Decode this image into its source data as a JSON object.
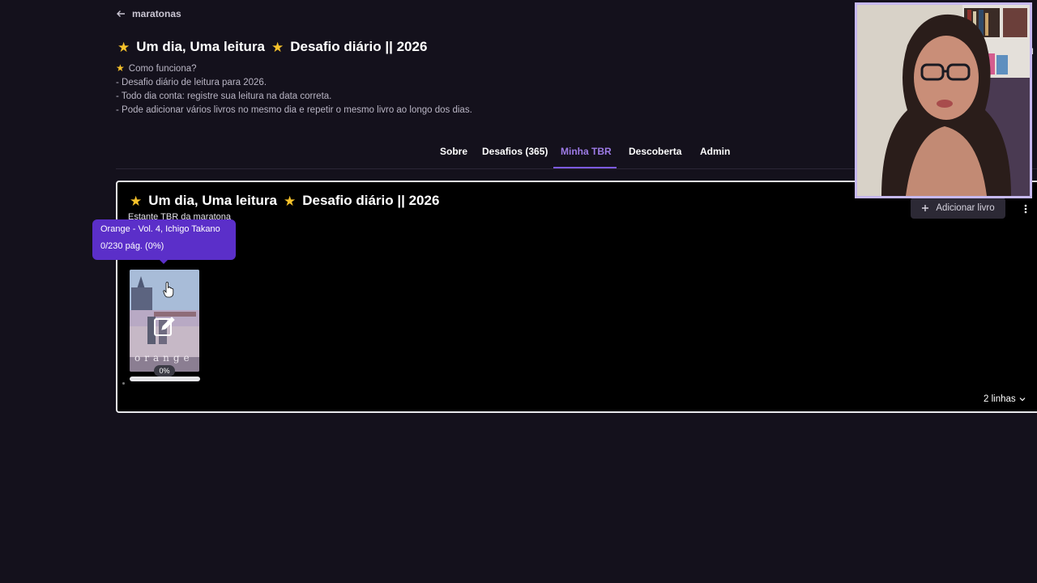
{
  "breadcrumb": {
    "back_label": "maratonas"
  },
  "header": {
    "title_part1": "Um dia, Uma leitura",
    "title_part2": "Desafio diário || 2026",
    "description": [
      "Como funciona?",
      "- Desafio diário de leitura para 2026.",
      "- Todo dia conta: registre sua leitura na data correta.",
      "- Pode adicionar vários livros no mesmo dia e repetir o mesmo livro ao longo dos dias."
    ]
  },
  "tabs": [
    {
      "label": "Sobre",
      "active": false
    },
    {
      "label": "Desafios (365)",
      "active": false
    },
    {
      "label": "Minha TBR",
      "active": true
    },
    {
      "label": "Descoberta",
      "active": false
    },
    {
      "label": "Admin",
      "active": false
    }
  ],
  "shelf": {
    "title_part1": "Um dia, Uma leitura",
    "title_part2": "Desafio diário || 2026",
    "subtitle": "Estante TBR da maratona",
    "add_book_label": "Adicionar livro",
    "rows_label": "2 linhas",
    "books": [
      {
        "tooltip_title": "Orange - Vol. 4, Ichigo Takano",
        "tooltip_pages": "0/230 pág. (0%)",
        "progress_label": "0%",
        "progress": 0,
        "cover_text": "orange"
      }
    ]
  },
  "colors": {
    "accent": "#7c5ae0",
    "accent_text": "#9d7be6",
    "star": "#f6c22b",
    "tooltip_bg": "#5b2fc9",
    "background": "#14111c",
    "card_bg": "#000000"
  },
  "icons": {
    "back": "arrow-left-icon",
    "star": "star-icon",
    "add": "plus-icon",
    "more": "vertical-dots-icon",
    "edit": "edit-icon",
    "chevron": "chevron-down-icon"
  },
  "side_clip_text": "I"
}
